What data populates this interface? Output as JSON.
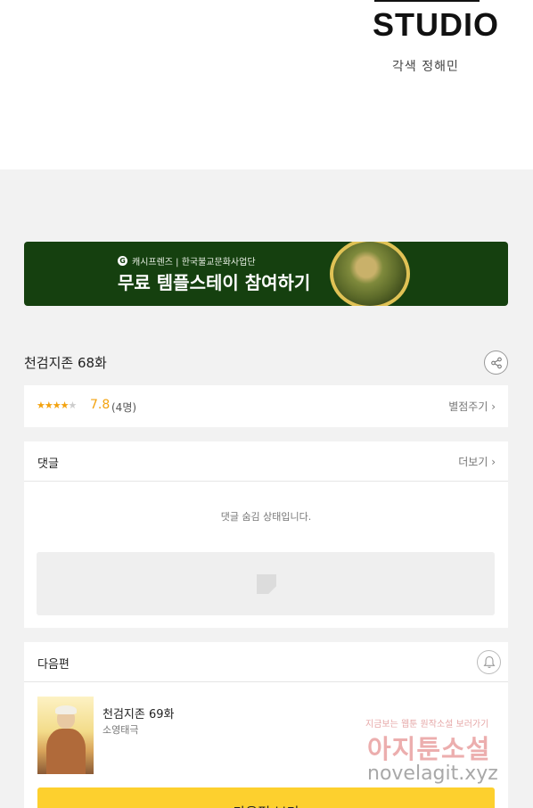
{
  "studio": {
    "logo": "STUDIO",
    "credit": "각색 정해민"
  },
  "banner": {
    "sponsor": "캐시프렌즈 | 한국불교문화사업단",
    "sponsor_icon": "G",
    "title": "무료 템플스테이 참여하기"
  },
  "episode": {
    "title": "천검지존 68화"
  },
  "rating": {
    "stars": 4,
    "max_stars": 5,
    "score": "7.8",
    "count": "(4명)",
    "rate_link": "별점주기 ›"
  },
  "comments": {
    "title": "댓글",
    "more_link": "더보기 ›",
    "hidden_message": "댓글 숨김 상태입니다."
  },
  "next": {
    "section_title": "다음편",
    "episode_title": "천검지존 69화",
    "author": "소영태극",
    "button_label": "다음편 보기"
  },
  "watermark": {
    "tagline": "지금보는 웹툰 원작소설 보러가기",
    "brand": "아지툰소설",
    "url": "novelagit.xyz"
  },
  "colors": {
    "banner_bg": "#15400f",
    "accent_star": "#f3a20e",
    "button_yellow": "#fdd02e"
  }
}
